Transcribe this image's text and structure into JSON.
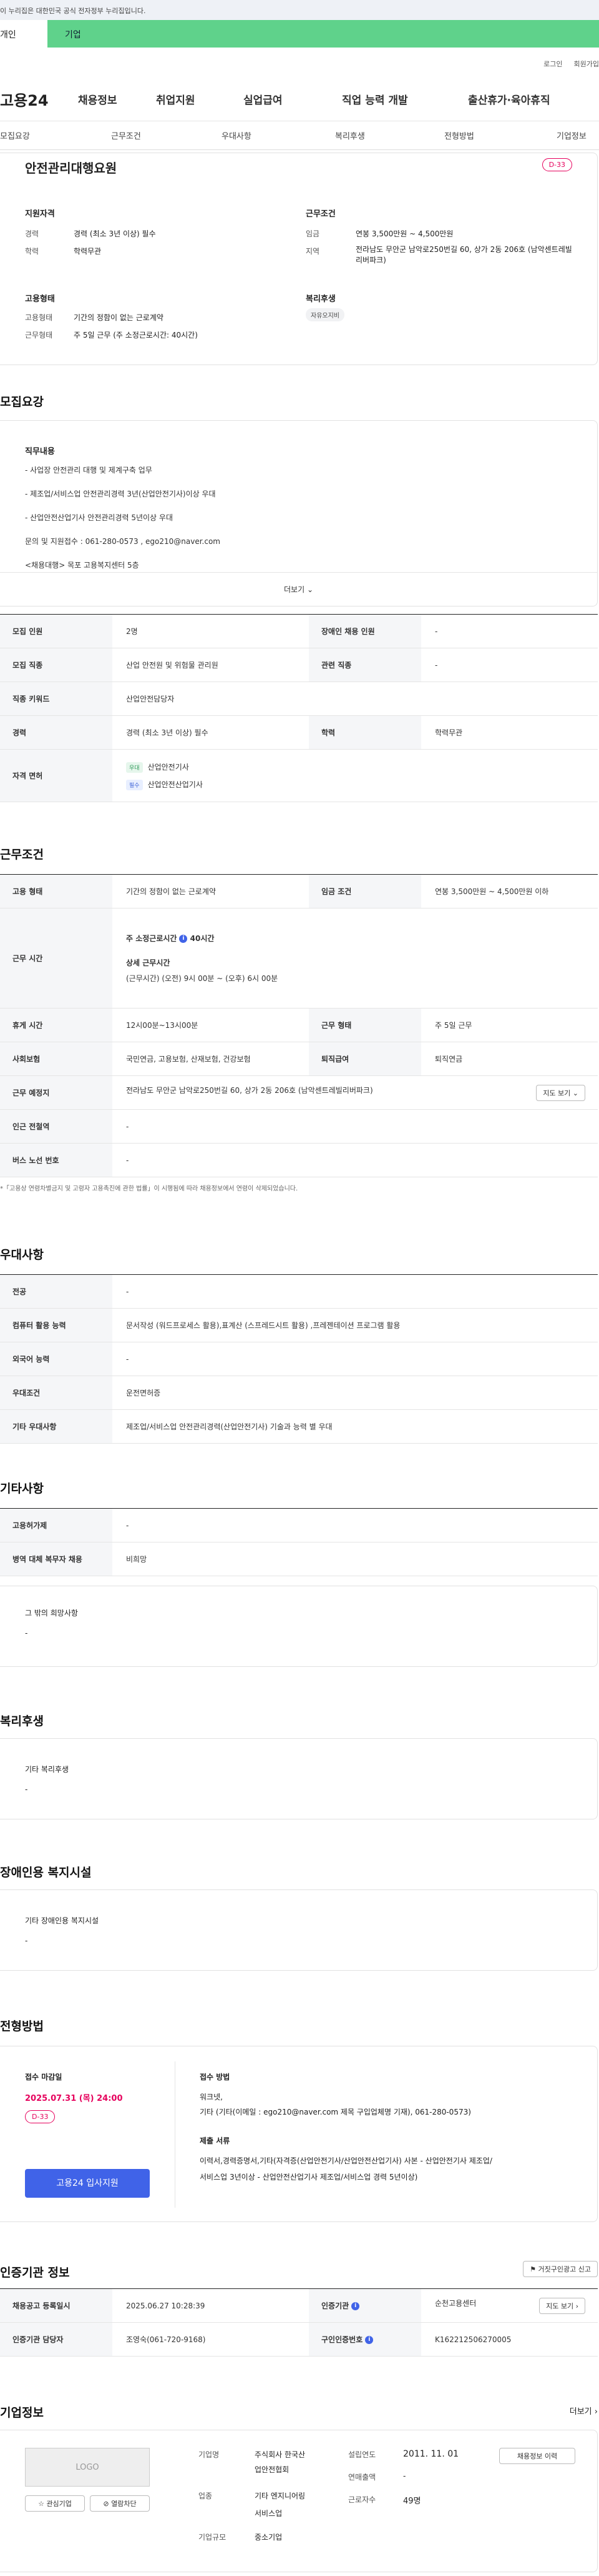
{
  "gov_banner": "이 누리집은 대한민국 공식 전자정부 누리집입니다.",
  "top_tabs": {
    "personal": "개인",
    "company": "기업"
  },
  "util": {
    "login": "로그인",
    "join": "회원가입"
  },
  "logo": "고용24",
  "gnb": [
    "채용정보",
    "취업지원",
    "실업급여",
    "직업 능력 개발",
    "출산휴가·육아휴직"
  ],
  "subnav": [
    "모집요강",
    "근무조건",
    "우대사항",
    "복리후생",
    "전형방법",
    "기업정보"
  ],
  "summary": {
    "title": "안전관리대행요원",
    "dday": "D-33",
    "qual_h": "지원자격",
    "career_k": "경력",
    "career_v": "경력 (최소 3년 이상) 필수",
    "edu_k": "학력",
    "edu_v": "학력무관",
    "work_h": "근무조건",
    "pay_k": "임금",
    "pay_v": "연봉 3,500만원 ~ 4,500만원",
    "loc_k": "지역",
    "loc_v": "전라남도 무안군 남악로250번길 60, 상가 2동 206호 (남악센트레빌리버파크)",
    "emp_h": "고용형태",
    "emptype_k": "고용형태",
    "emptype_v": "기간의 정함이 없는 근로계약",
    "worktype_k": "근무형태",
    "worktype_v": "주 5일 근무 (주 소정근로시간: 40시간)",
    "welfare_h": "복리후생",
    "welfare_tag": "자유오지비"
  },
  "recruit": {
    "title": "모집요강",
    "duty_h": "직무내용",
    "lines": [
      "- 사업장 안전관리 대행 및 제계구축 업무",
      "- 제조업/서비스업 안전관리경력 3년(산업안전기사)이상 우대",
      "- 산업안전산업기사 안전관리경력 5년이상 우대",
      "문의 및 지원접수 : 061-280-0573 , ego210@naver.com",
      "<채용대행> 목포 고용복지센터 5층"
    ],
    "more": "더보기",
    "rows": {
      "count_k": "모집 인원",
      "count_v": "2명",
      "disab_k": "장애인 채용 인원",
      "disab_v": "-",
      "job_k": "모집 직종",
      "job_v": "산업 안전원 및 위험물 관리원",
      "rel_k": "관련 직종",
      "rel_v": "-",
      "kw_k": "직종 키워드",
      "kw_v": "산업안전담당자",
      "career_k": "경력",
      "career_v": "경력 (최소 3년 이상) 필수",
      "edu_k": "학력",
      "edu_v": "학력무관",
      "lic_k": "자격 면허",
      "lic1_badge": "우대",
      "lic1": "산업안전기사",
      "lic2_badge": "필수",
      "lic2": "산업안전산업기사"
    }
  },
  "cond": {
    "title": "근무조건",
    "emp_k": "고용 형태",
    "emp_v": "기간의 정함이 없는 근로계약",
    "wage_k": "임금 조건",
    "wage_v": "연봉 3,500만원 ~ 4,500만원 이하",
    "time_k": "근무 시간",
    "time_std": "주 소정근로시간",
    "time_hours": "40시간",
    "time_detail_h": "상세 근무시간",
    "time_detail": "(근무시간) (오전) 9시 00분 ~ (오후) 6시 00분",
    "rest_k": "휴게 시간",
    "rest_v": "12시00분~13시00분",
    "form_k": "근무 형태",
    "form_v": "주 5일 근무",
    "ins_k": "사회보험",
    "ins_v": "국민연금, 고용보험, 산재보험, 건강보험",
    "ret_k": "퇴직급여",
    "ret_v": "퇴직연금",
    "addr_k": "근무 예정지",
    "addr_v": "전라남도 무안군 남악로250번길 60, 상가 2동 206호 (남악센트레빌리버파크)",
    "map_btn": "지도 보기",
    "sub_k": "인근 전철역",
    "sub_v": "-",
    "bus_k": "버스 노선 번호",
    "bus_v": "-",
    "note": "*「고용상 연령차별금지 및 고령자 고용촉진에 관한 법률」이 시행됨에 따라 채용정보에서 연령이 삭제되었습니다."
  },
  "pref": {
    "title": "우대사항",
    "major_k": "전공",
    "major_v": "-",
    "comp_k": "컴퓨터 활용 능력",
    "comp_v": "문서작성 (워드프로세스 활용),표계산 (스프레드시트 활용) ,프레젠테이션 프로그램 활용",
    "lang_k": "외국어 능력",
    "lang_v": "-",
    "cond_k": "우대조건",
    "cond_v": "운전면허증",
    "etc_k": "기타 우대사항",
    "etc_v": "제조업/서비스업 안전관리경력(산업안전기사) 기술과 능력 별 우대"
  },
  "other": {
    "title": "기타사항",
    "type_k": "고용허가제",
    "type_v": "-",
    "mil_k": "병역 대체 복무자 채용",
    "mil_v": "비희망",
    "hope_h": "그 밖의 희망사항",
    "hope_v": "-"
  },
  "benefit": {
    "title": "복리후생",
    "h": "기타 복리후생",
    "v": "-"
  },
  "disab": {
    "title": "장애인용 복지시설",
    "h": "기타 장애인용 복지시설",
    "v": "-"
  },
  "select": {
    "title": "전형방법",
    "deadline_h": "접수 마감일",
    "deadline": "2025.07.31 (목) 24:00",
    "dday": "D-33",
    "apply": "고용24 입사지원",
    "method_h": "접수 방법",
    "method1": "워크넷,",
    "method2": "기타 (기타(이메일 : ego210@naver.com 제목 구입업체명 기재), 061-280-0573)",
    "docs_h": "제출 서류",
    "docs1": "이력서,경력증명서,기타(자격증(산업안전기사/산업안전산업기사) 사본 - 산업안전기사 제조업/",
    "docs2": "서비스업 3년이상 - 산업안전산업기사 제조업/서비스업 경력 5년이상)"
  },
  "cert": {
    "title": "인증기관 정보",
    "report_btn": "거짓구인광고 신고",
    "reg_k": "채용공고 등록일시",
    "reg_v": "2025.06.27 10:28:39",
    "org_k": "인증기관",
    "org_v": "순천고용센터",
    "map_btn": "지도 보기",
    "mgr_k": "인증기관 담당자",
    "mgr_v": "조영숙(061-720-9168)",
    "no_k": "구인인증번호",
    "no_v": "K162212506270005"
  },
  "company": {
    "title": "기업정보",
    "more": "더보기",
    "logo_placeholder": "LOGO",
    "fav_btn": "관심기업",
    "block_btn": "열람차단",
    "name_k": "기업명",
    "name_v1": "주식회사 한국산",
    "name_v2": "업안전협회",
    "ind_k": "업종",
    "ind_v1": "기타 엔지니어링",
    "ind_v2": "서비스업",
    "size_k": "기업규모",
    "size_v": "중소기업",
    "year_k": "설립연도",
    "year_v": "2011. 11. 01",
    "sales_k": "연매출액",
    "sales_v": "-",
    "emp_k": "근로자수",
    "emp_v": "49명",
    "jobs_btn": "채용정보 이력"
  }
}
